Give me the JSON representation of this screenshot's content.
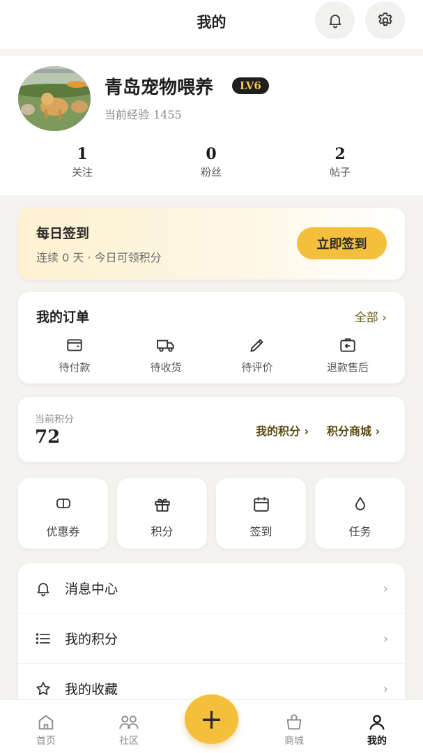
{
  "header": {
    "title": "我的"
  },
  "profile": {
    "username": "青岛宠物喂养",
    "level": "LV6",
    "exp_label": "当前经验",
    "exp_value": "1455",
    "stats": [
      {
        "value": "1",
        "label": "关注"
      },
      {
        "value": "0",
        "label": "粉丝"
      },
      {
        "value": "2",
        "label": "帖子"
      }
    ]
  },
  "signin": {
    "title": "每日签到",
    "subtitle": "连续 0 天 · 今日可领积分",
    "button": "立即签到"
  },
  "orders": {
    "title": "我的订单",
    "all_link": "全部 ›",
    "items": [
      {
        "label": "待付款",
        "icon": "wallet-icon"
      },
      {
        "label": "待收货",
        "icon": "truck-icon"
      },
      {
        "label": "待评价",
        "icon": "pencil-icon"
      },
      {
        "label": "退款售后",
        "icon": "refund-icon"
      }
    ]
  },
  "points": {
    "label": "当前积分",
    "value": "72",
    "my_points_link": "我的积分 ›",
    "mall_link": "积分商城 ›"
  },
  "tiles": [
    {
      "label": "优惠券",
      "icon": "coupon-icon"
    },
    {
      "label": "积分",
      "icon": "gift-icon"
    },
    {
      "label": "签到",
      "icon": "calendar-icon"
    },
    {
      "label": "任务",
      "icon": "drop-icon"
    }
  ],
  "menu": [
    {
      "label": "消息中心",
      "icon": "bell-icon"
    },
    {
      "label": "我的积分",
      "icon": "list-icon"
    },
    {
      "label": "我的收藏",
      "icon": "star-icon"
    }
  ],
  "bottom_nav": [
    {
      "label": "首页",
      "icon": "home-icon"
    },
    {
      "label": "社区",
      "icon": "community-icon"
    },
    {
      "label": "商城",
      "icon": "shop-icon"
    },
    {
      "label": "我的",
      "icon": "user-icon",
      "active": true
    }
  ],
  "colors": {
    "accent": "#f4c03c",
    "badge_bg": "#1f1f1f",
    "badge_text": "#f3c955"
  }
}
